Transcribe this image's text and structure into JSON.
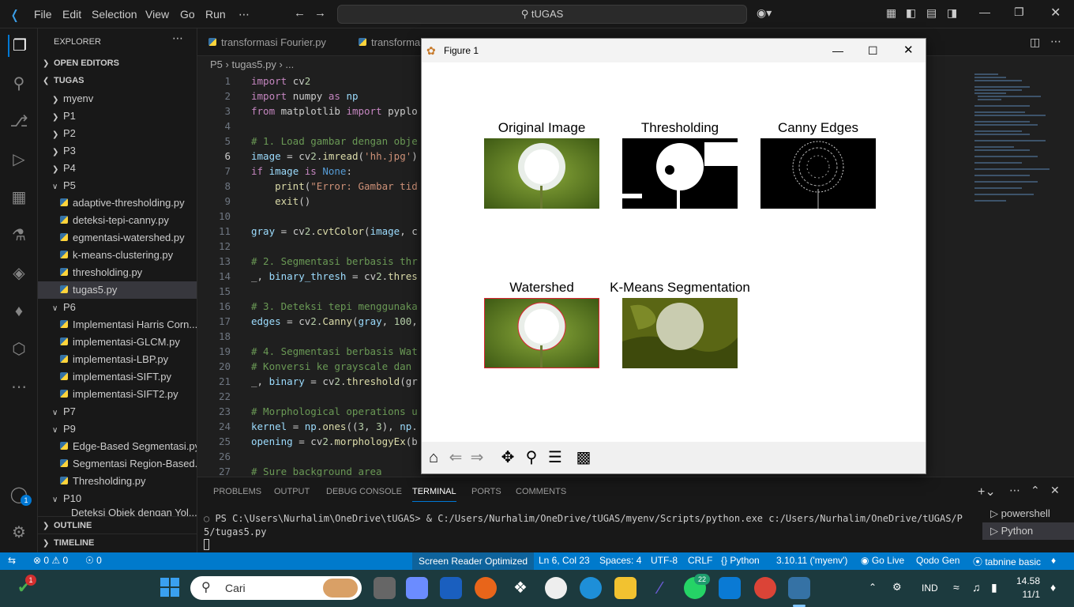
{
  "titlebar": {
    "menus": [
      "File",
      "Edit",
      "Selection",
      "View",
      "Go",
      "Run",
      "⋯"
    ],
    "command_center": "tUGAS"
  },
  "sidebar": {
    "title": "EXPLORER",
    "open_editors": "OPEN EDITORS",
    "root": "TUGAS",
    "folders_top": [
      "myenv",
      "P1",
      "P2",
      "P3",
      "P4",
      "P5"
    ],
    "p5_files": [
      "adaptive-thresholding.py",
      "deteksi-tepi-canny.py",
      "egmentasi-watershed.py",
      "k-means-clustering.py",
      "thresholding.py",
      "tugas5.py"
    ],
    "p6": "P6",
    "p6_files": [
      "Implementasi Harris Corn...",
      "implementasi-GLCM.py",
      "implementasi-LBP.py",
      "implementasi-SIFT.py",
      "implementasi-SIFT2.py"
    ],
    "p7": "P7",
    "p9": "P9",
    "p9_files": [
      "Edge-Based Segmentasi.py",
      "Segmentasi Region-Based...",
      "Thresholding.py"
    ],
    "p10": "P10",
    "p10_file": "Deteksi Objek dengan Yol...",
    "outline": "OUTLINE",
    "timeline": "TIMELINE"
  },
  "tabs": [
    "transformasi Fourier.py",
    "transforma"
  ],
  "breadcrumb": "P5 › tugas5.py › ...",
  "code_lines": [
    "import cv2",
    "import numpy as np",
    "from matplotlib import pyplo",
    "",
    "# 1. Load gambar dengan obje",
    "image = cv2.imread('hh.jpg')",
    "if image is None:",
    "    print(\"Error: Gambar tid",
    "    exit()",
    "",
    "gray = cv2.cvtColor(image, c",
    "",
    "# 2. Segmentasi berbasis thr",
    "_, binary_thresh = cv2.thres",
    "",
    "# 3. Deteksi tepi menggunaka",
    "edges = cv2.Canny(gray, 100,",
    "",
    "# 4. Segmentasi berbasis Wat",
    "# Konversi ke grayscale dan",
    "_, binary = cv2.threshold(gr",
    "",
    "# Morphological operations u",
    "kernel = np.ones((3, 3), np.",
    "opening = cv2.morphologyEx(b",
    "",
    "# Sure background area"
  ],
  "panel": {
    "tabs": [
      "PROBLEMS",
      "OUTPUT",
      "DEBUG CONSOLE",
      "TERMINAL",
      "PORTS",
      "COMMENTS"
    ],
    "active_tab": "TERMINAL",
    "terminal_text": "PS C:\\Users\\Nurhalim\\OneDrive\\tUGAS> & C:/Users/Nurhalim/OneDrive/tUGAS/myenv/Scripts/python.exe c:/Users/Nurhalim/OneDrive/tUGAS/P5/tugas5.py",
    "terminals": [
      "powershell",
      "Python"
    ]
  },
  "status": {
    "errors": "0",
    "warnings": "0",
    "ports": "0",
    "screen_reader": "Screen Reader Optimized",
    "position": "Ln 6, Col 23",
    "spaces": "Spaces: 4",
    "encoding": "UTF-8",
    "eol": "CRLF",
    "language": "{} Python",
    "interpreter": "3.10.11 ('myenv')",
    "golive": "Go Live",
    "qodo": "Qodo Gen",
    "tabnine": "tabnine basic"
  },
  "figure": {
    "window_title": "Figure 1",
    "titles": [
      "Original Image",
      "Thresholding",
      "Canny Edges",
      "Watershed",
      "K-Means Segmentation"
    ]
  },
  "taskbar": {
    "search_placeholder": "Cari",
    "lang": "IND",
    "time": "14.58",
    "date": "11/1",
    "badge_notif": "1",
    "badge_whatsapp": "22",
    "badge_account": "1"
  },
  "colors": {
    "status_bar": "#007acc",
    "accent": "#0078d4"
  }
}
